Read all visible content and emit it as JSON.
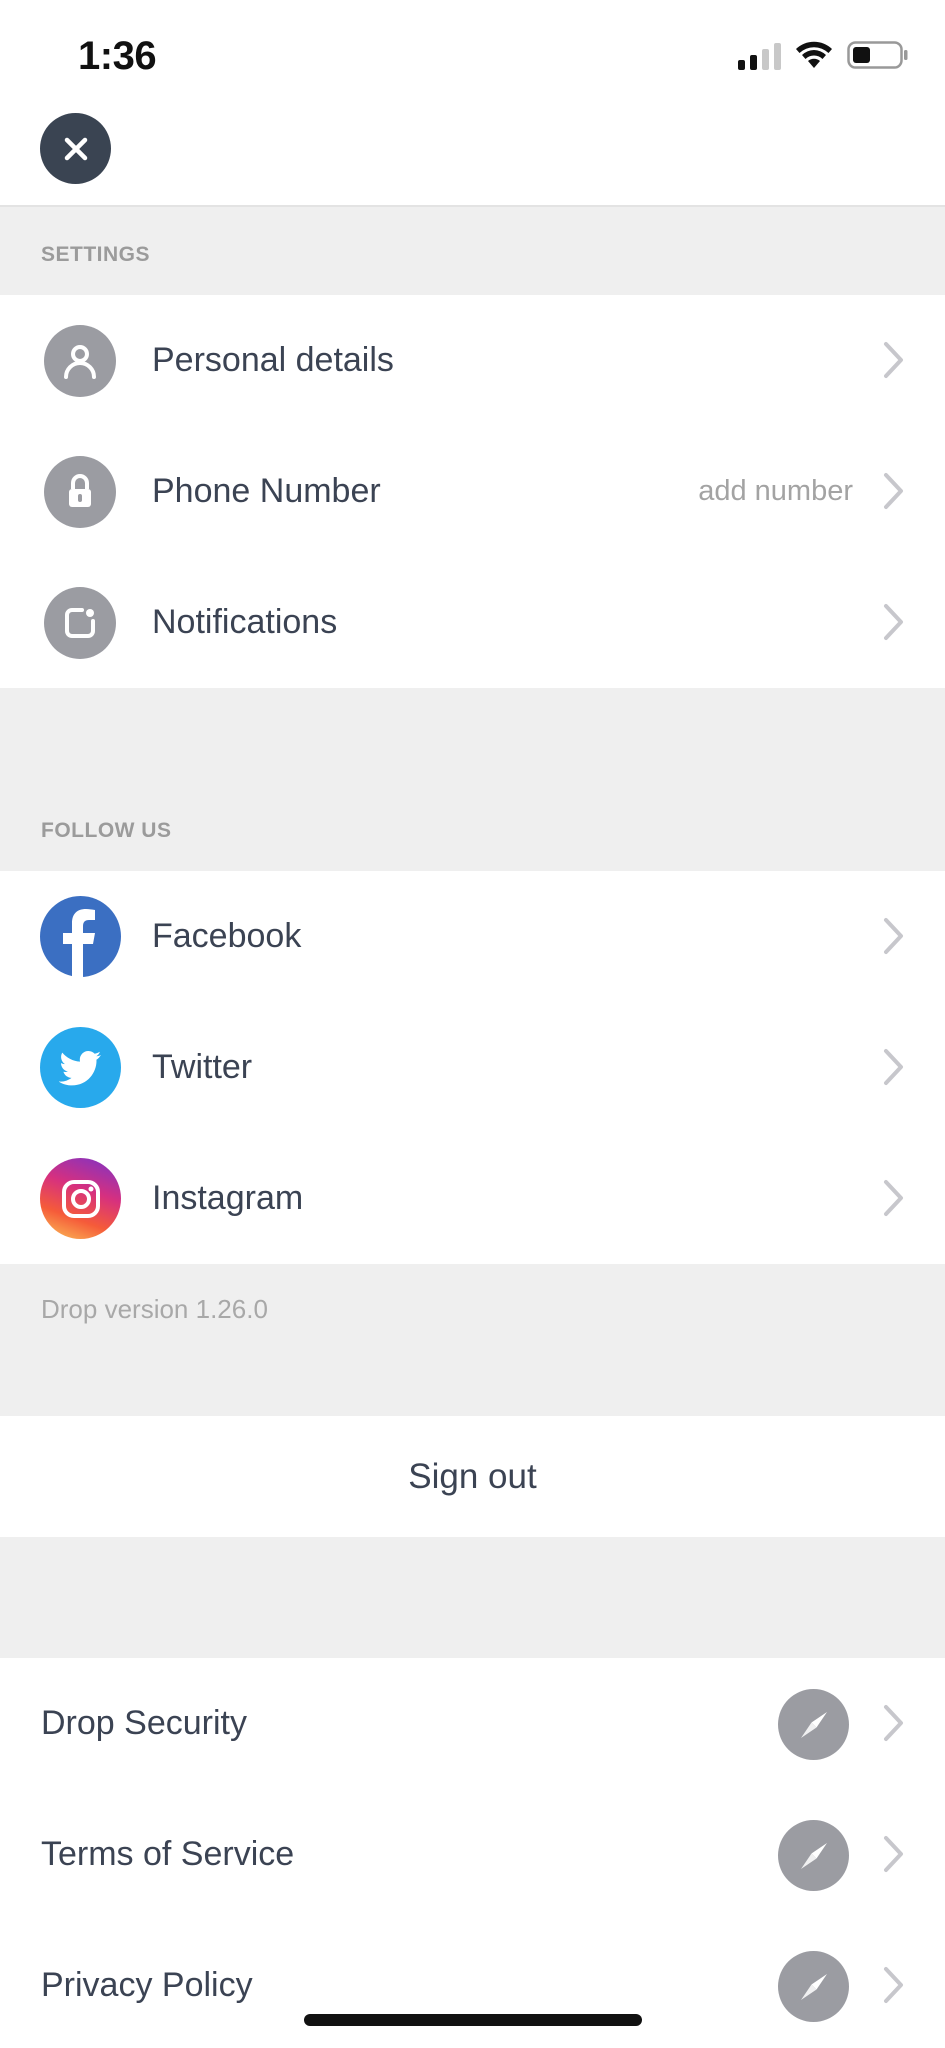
{
  "status_bar": {
    "time": "1:36"
  },
  "settings": {
    "header": "SETTINGS",
    "items": [
      {
        "label": "Personal details",
        "detail": "",
        "icon": "person-icon"
      },
      {
        "label": "Phone Number",
        "detail": "add number",
        "icon": "lock-icon"
      },
      {
        "label": "Notifications",
        "detail": "",
        "icon": "notification-icon"
      }
    ]
  },
  "follow": {
    "header": "FOLLOW US",
    "items": [
      {
        "label": "Facebook",
        "icon": "facebook-icon",
        "color": "#3b6fc2"
      },
      {
        "label": "Twitter",
        "icon": "twitter-icon",
        "color": "#28a9ec"
      },
      {
        "label": "Instagram",
        "icon": "instagram-icon",
        "color": "#d6307f"
      }
    ]
  },
  "version_text": "Drop version 1.26.0",
  "sign_out_label": "Sign out",
  "links": {
    "items": [
      {
        "label": "Drop Security",
        "icon": "compass-icon"
      },
      {
        "label": "Terms of Service",
        "icon": "compass-icon"
      },
      {
        "label": "Privacy Policy",
        "icon": "compass-icon"
      }
    ]
  },
  "colors": {
    "section_background": "#efefef",
    "text": "#3b4353",
    "icon_gray": "#9b9ca2",
    "close_button": "#3a4452"
  }
}
